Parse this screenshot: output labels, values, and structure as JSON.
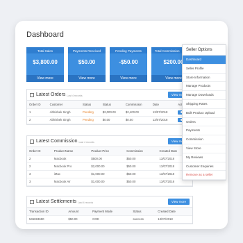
{
  "page_title": "Dashboard",
  "stats": [
    {
      "title": "Total Sales",
      "value": "$3,800.00",
      "link": "View more"
    },
    {
      "title": "Payments Received",
      "value": "$50.00",
      "link": "View more"
    },
    {
      "title": "Pending Payments",
      "value": "-$50.00",
      "link": "View more"
    },
    {
      "title": "Total Commission",
      "value": "$200.00",
      "link": "View more"
    }
  ],
  "orders": {
    "title": "Latest Orders",
    "sub": "Last 4 records",
    "view_more": "View more",
    "columns": [
      "Order ID",
      "Customer",
      "Status",
      "Status",
      "Commission",
      "Date",
      "Action"
    ],
    "rows": [
      [
        "1",
        "Abhishek Singh",
        "Pending",
        "$2,000.00",
        "$2,400.00",
        "13/07/2018"
      ],
      [
        "2",
        "Abhishek Singh",
        "Pending",
        "$0.00",
        "$0.00",
        "13/07/2018"
      ]
    ]
  },
  "commission": {
    "title": "Latest Commission",
    "sub": "Last 4 records",
    "view_more": "View more",
    "columns": [
      "Order ID",
      "Product Name",
      "Product Price",
      "Commission",
      "Created Date"
    ],
    "rows": [
      [
        "2",
        "Macbook",
        "$500.00",
        "$50.00",
        "13/07/2018"
      ],
      [
        "2",
        "Macbook Pro",
        "$2,000.00",
        "$50.00",
        "13/07/2018"
      ],
      [
        "3",
        "iMac",
        "$1,000.00",
        "$50.00",
        "13/07/2018"
      ],
      [
        "3",
        "Macbook Air",
        "$1,000.00",
        "$50.00",
        "13/07/2018"
      ]
    ]
  },
  "settlements": {
    "title": "Latest Settlements",
    "sub": "Last 4 records",
    "view_more": "View more",
    "columns": [
      "Transaction ID",
      "Amount",
      "Payment Mode",
      "Status",
      "Created Date"
    ],
    "rows": [
      [
        "545693690",
        "$50.00",
        "COD",
        "success",
        "13/07/2018"
      ]
    ]
  },
  "seller_menu": {
    "header": "Seller Options",
    "items": [
      "Dashboard",
      "Seller Profile",
      "Store Information",
      "Manage Products",
      "Manage Downloads",
      "Shipping Rates",
      "Bulk Product Upload",
      "Orders",
      "Payments",
      "Commission",
      "View Store",
      "My Reviews",
      "Customer Enquiries",
      "Remove as a seller"
    ]
  },
  "colors": {
    "accent": "#3d8fe0",
    "pending": "#e67e22",
    "danger": "#d9534f"
  }
}
